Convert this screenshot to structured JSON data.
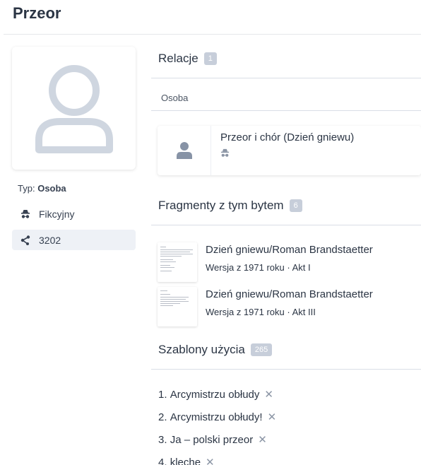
{
  "page": {
    "title": "Przeor"
  },
  "sidebar": {
    "type_prefix": "Typ:",
    "type_value": "Osoba",
    "items": [
      {
        "icon": "incognito-icon",
        "label": "Fikcyjny"
      },
      {
        "icon": "share-nodes-icon",
        "label": "3202"
      }
    ]
  },
  "relations": {
    "title": "Relacje",
    "count": "1",
    "column_label": "Osoba",
    "items": [
      {
        "name": "Przeor i chór (Dzień gniewu)",
        "icon": "incognito-icon"
      }
    ]
  },
  "fragments": {
    "title": "Fragmenty z tym bytem",
    "count": "6",
    "items": [
      {
        "title": "Dzień gniewu/Roman Brandstaetter",
        "subtitle": "Wersja z 1971 roku · Akt I"
      },
      {
        "title": "Dzień gniewu/Roman Brandstaetter",
        "subtitle": "Wersja z 1971 roku · Akt III"
      }
    ]
  },
  "templates": {
    "title": "Szablony użycia",
    "count": "265",
    "remove_glyph": "✕",
    "items": [
      {
        "num": "1.",
        "label": "Arcymistrzu obłudy"
      },
      {
        "num": "2.",
        "label": "Arcymistrzu obłudy!"
      },
      {
        "num": "3.",
        "label": "Ja – polski przeor"
      },
      {
        "num": "4.",
        "label": "klechę"
      }
    ]
  },
  "colors": {
    "accent_badge": "#c7ceda",
    "avatar_gray": "#cfd6e0",
    "icon_dark": "#374151"
  }
}
